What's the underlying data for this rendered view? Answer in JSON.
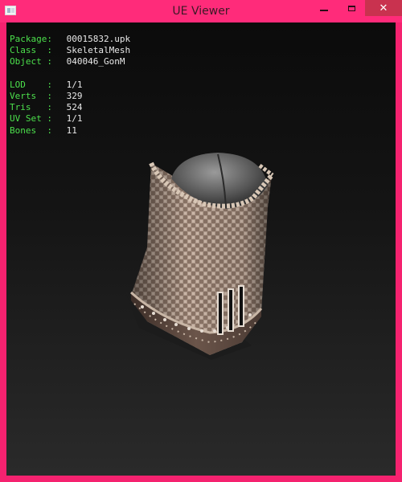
{
  "window": {
    "title": "UE Viewer",
    "controls": {
      "minimize": "—",
      "maximize": "□",
      "close": "✕"
    },
    "colors": {
      "frame": "#ff2b7a",
      "close_bg": "#c9324f",
      "viewport_top": "#0b0b0b",
      "viewport_bottom": "#2a2a2a"
    }
  },
  "object_info": {
    "package": {
      "label": "Package:",
      "value": "00015832.upk"
    },
    "class": {
      "label": "Class  :",
      "value": "SkeletalMesh"
    },
    "object": {
      "label": "Object :",
      "value": "040046_GonM"
    }
  },
  "mesh_stats": {
    "lod": {
      "label": "LOD    :",
      "value": "1/1"
    },
    "verts": {
      "label": "Verts  :",
      "value": "329"
    },
    "tris": {
      "label": "Tris   :",
      "value": "524"
    },
    "uvset": {
      "label": "UV Set :",
      "value": "1/1"
    },
    "bones": {
      "label": "Bones  :",
      "value": "11"
    }
  },
  "colors": {
    "label_text": "#4ce04c",
    "value_text": "#e8e8e8"
  }
}
